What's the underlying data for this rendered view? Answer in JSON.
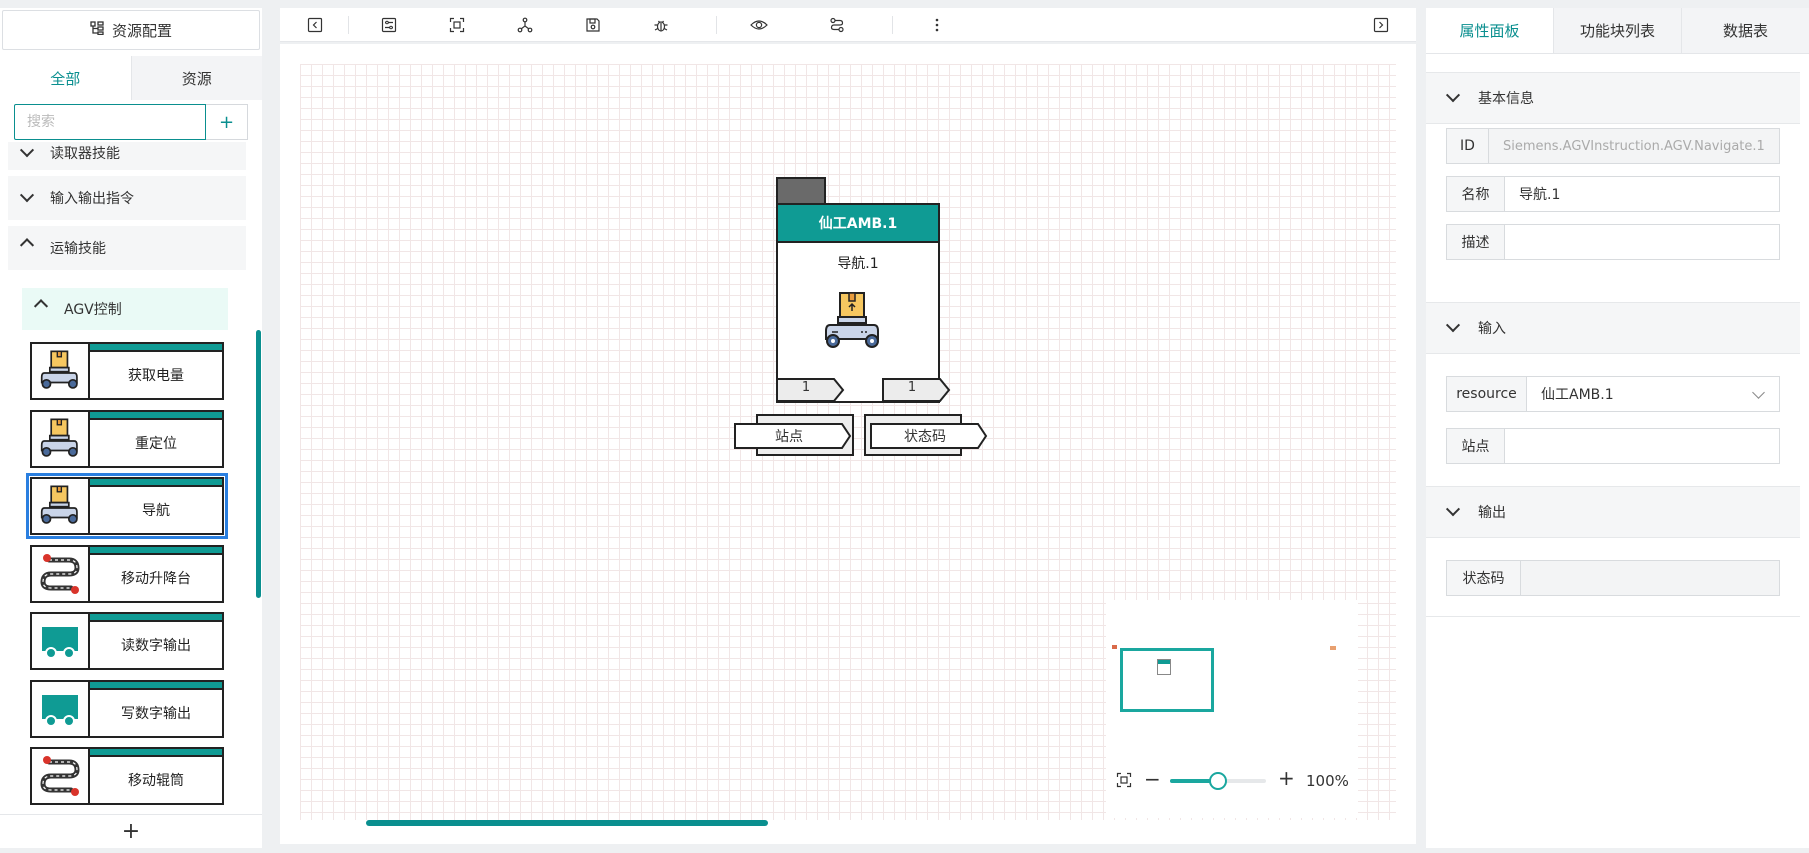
{
  "left_panel": {
    "resource_config_label": "资源配置",
    "tabs": [
      "全部",
      "资源"
    ],
    "search_placeholder": "搜索",
    "add_label": "+",
    "categories": [
      {
        "label": "读取器技能",
        "expanded": false
      },
      {
        "label": "输入输出指令",
        "expanded": false
      },
      {
        "label": "运输技能",
        "expanded": true
      }
    ],
    "subcategory": {
      "label": "AGV控制",
      "expanded": true
    },
    "blocks": [
      {
        "label": "获取电量",
        "icon": "agv-robot-icon"
      },
      {
        "label": "重定位",
        "icon": "agv-robot-icon"
      },
      {
        "label": "导航",
        "icon": "agv-robot-icon",
        "selected": true
      },
      {
        "label": "移动升降台",
        "icon": "route-pin-icon"
      },
      {
        "label": "读数字输出",
        "icon": "teal-truck-icon"
      },
      {
        "label": "写数字输出",
        "icon": "teal-truck-icon"
      },
      {
        "label": "移动辊筒",
        "icon": "route-pin-icon"
      }
    ],
    "bottom_add_label": "+"
  },
  "toolbar": {
    "icons": [
      "collapse-left-icon",
      "settings-sliders-icon",
      "fit-view-icon",
      "graph-nodes-icon",
      "save-icon",
      "debug-bug-icon",
      "preview-eye-icon",
      "flow-route-icon",
      "more-vertical-icon",
      "collapse-right-icon"
    ]
  },
  "canvas": {
    "node": {
      "title": "仙工AMB.1",
      "subtitle": "导航.1",
      "port_left": "1",
      "port_right": "1",
      "input_pin": "站点",
      "output_pin": "状态码"
    },
    "zoom": {
      "value": 0.5,
      "label": "100%"
    }
  },
  "right_panel": {
    "tabs": [
      "属性面板",
      "功能块列表",
      "数据表"
    ],
    "sections": {
      "basic": {
        "title": "基本信息"
      },
      "input": {
        "title": "输入"
      },
      "output": {
        "title": "输出"
      }
    },
    "fields": {
      "id": {
        "key": "ID",
        "value": "Siemens.AGVInstruction.AGV.Navigate.1"
      },
      "name": {
        "key": "名称",
        "value": "导航.1"
      },
      "desc": {
        "key": "描述",
        "value": ""
      },
      "resource": {
        "key": "resource",
        "value": "仙工AMB.1"
      },
      "site": {
        "key": "站点",
        "value": ""
      },
      "status": {
        "key": "状态码",
        "value": ""
      }
    }
  },
  "colors": {
    "accent": "#0a8f8f",
    "node_header": "#0f9b94",
    "selection": "#2a7fe0"
  }
}
